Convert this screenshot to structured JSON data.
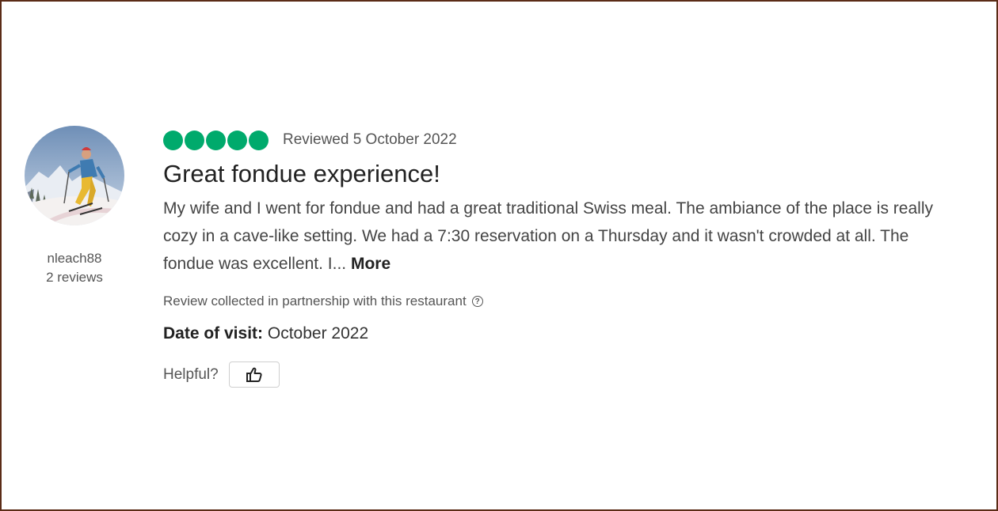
{
  "reviewer": {
    "username": "nleach88",
    "review_count": "2 reviews",
    "avatar_icon": "skier-avatar-photo"
  },
  "review": {
    "rating": 5,
    "rating_max": 5,
    "rating_color": "#00aa6c",
    "date": "Reviewed 5 October 2022",
    "title": "Great fondue experience!",
    "text": "My wife and I went for fondue and had a great traditional Swiss meal. The ambiance of the place is really cozy in a cave-like setting. We had a 7:30 reservation on a Thursday and it wasn't crowded at all. The fondue was excellent. I... ",
    "more_label": "More",
    "partnership_note": "Review collected in partnership with this restaurant",
    "partnership_icon": "question-circle-icon",
    "visit_label": "Date of visit:",
    "visit_value": " October 2022",
    "helpful_label": "Helpful?",
    "helpful_icon": "thumbs-up-icon"
  }
}
